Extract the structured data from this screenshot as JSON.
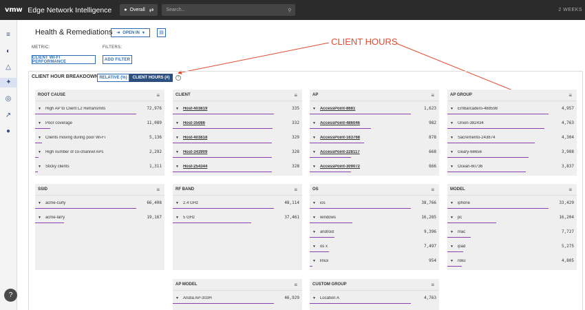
{
  "topbar": {
    "logo": "vmw",
    "title": "Edge Network Intelligence",
    "scope": "Overall",
    "search_placeholder": "Search...",
    "time_range": "2 WEEKS"
  },
  "page": {
    "title": "Health & Remediations",
    "open_in": "OPEN IN",
    "metric_label": "METRIC:",
    "metric_value": "CLIENT WI-FI PERFORMANCE",
    "filters_label": "FILTERS:",
    "add_filter": "ADD FILTER"
  },
  "annotation": "CLIENT HOURS",
  "breakdown": {
    "title": "CLIENT HOUR BREAKDOWN",
    "relative": "RELATIVE (%)",
    "client_hours": "CLIENT HOURS (#)"
  },
  "colors": {
    "bar": "#8a3fb0",
    "accent": "#2d6ab2",
    "annotation": "#e24a2f"
  },
  "cards": [
    {
      "title": "ROOT CAUSE",
      "link": false,
      "rows": [
        {
          "name": "High AP to Client L2 Retransmits",
          "value": "72,976",
          "v": 72976
        },
        {
          "name": "Poor coverage",
          "value": "11,089",
          "v": 11089
        },
        {
          "name": "Clients moving during poor Wi-Fi",
          "value": "5,136",
          "v": 5136
        },
        {
          "name": "High number of co-channel APs",
          "value": "2,292",
          "v": 2292
        },
        {
          "name": "Sticky clients",
          "value": "1,311",
          "v": 1311
        }
      ]
    },
    {
      "title": "CLIENT",
      "link": true,
      "rows": [
        {
          "name": "Host-403819",
          "value": "335",
          "v": 335
        },
        {
          "name": "Host-35086",
          "value": "332",
          "v": 332
        },
        {
          "name": "Host-403818",
          "value": "329",
          "v": 329
        },
        {
          "name": "Host-343909",
          "value": "328",
          "v": 328
        },
        {
          "name": "Host-254344",
          "value": "328",
          "v": 328
        }
      ]
    },
    {
      "title": "AP",
      "link": true,
      "rows": [
        {
          "name": "AccessPoint-8681",
          "value": "1,623",
          "v": 1623
        },
        {
          "name": "AccessPoint-486046",
          "value": "982",
          "v": 982
        },
        {
          "name": "AccessPoint-163768",
          "value": "878",
          "v": 878
        },
        {
          "name": "AccessPoint-228117",
          "value": "668",
          "v": 668
        },
        {
          "name": "AccessPoint-309072",
          "value": "666",
          "v": 666
        }
      ]
    },
    {
      "title": "AP GROUP",
      "link": false,
      "rows": [
        {
          "name": "Embarcadero-488598",
          "value": "4,957",
          "v": 4957
        },
        {
          "name": "Union-382434",
          "value": "4,763",
          "v": 4763
        },
        {
          "name": "Sacremento-243874",
          "value": "4,304",
          "v": 4304
        },
        {
          "name": "Geary-66656",
          "value": "3,988",
          "v": 3988
        },
        {
          "name": "Ocean-60736",
          "value": "3,837",
          "v": 3837
        }
      ]
    },
    {
      "title": "SSID",
      "link": false,
      "rows": [
        {
          "name": "acme-curly",
          "value": "66,408",
          "v": 66408
        },
        {
          "name": "acme-larry",
          "value": "19,167",
          "v": 19167
        }
      ]
    },
    {
      "title": "RF BAND",
      "link": false,
      "rows": [
        {
          "name": "2.4 GHz",
          "value": "48,114",
          "v": 48114
        },
        {
          "name": "5 GHz",
          "value": "37,461",
          "v": 37461
        }
      ]
    },
    {
      "title": "OS",
      "link": false,
      "rows": [
        {
          "name": "ios",
          "value": "38,766",
          "v": 38766
        },
        {
          "name": "windows",
          "value": "16,285",
          "v": 16285
        },
        {
          "name": "android",
          "value": "9,396",
          "v": 9396
        },
        {
          "name": "os x",
          "value": "7,497",
          "v": 7497
        },
        {
          "name": "linux",
          "value": "954",
          "v": 954
        }
      ]
    },
    {
      "title": "MODEL",
      "link": false,
      "rows": [
        {
          "name": "iphone",
          "value": "33,429",
          "v": 33429
        },
        {
          "name": "pc",
          "value": "16,204",
          "v": 16204
        },
        {
          "name": "mac",
          "value": "7,727",
          "v": 7727
        },
        {
          "name": "ipad",
          "value": "5,275",
          "v": 5275
        },
        {
          "name": "roku",
          "value": "4,805",
          "v": 4805
        }
      ]
    },
    {
      "title": "AP MODEL",
      "link": false,
      "rows": [
        {
          "name": "Aruba AP-303H",
          "value": "46,929",
          "v": 46929
        }
      ]
    },
    {
      "title": "CUSTOM GROUP",
      "link": false,
      "rows": [
        {
          "name": "Location A",
          "value": "4,763",
          "v": 4763
        }
      ]
    }
  ]
}
